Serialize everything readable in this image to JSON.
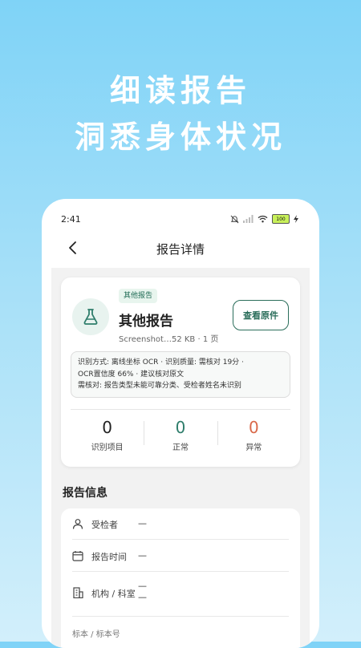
{
  "promo": {
    "line1": "细读报告",
    "line2": "洞悉身体状况"
  },
  "status_bar": {
    "time": "2:41",
    "battery": "100"
  },
  "nav": {
    "title": "报告详情"
  },
  "report": {
    "tag": "其他报告",
    "name": "其他报告",
    "file_info": "Screenshot…52 KB · 1 页",
    "view_button": "查看原件",
    "ocr_lines": [
      "识别方式: 离线坐标 OCR · 识别质量: 需核对 19分 ·",
      "OCR置信度 66% · 建议核对原文",
      "需核对: 报告类型未能可靠分类、受检者姓名未识别"
    ],
    "stats": [
      {
        "value": "0",
        "label": "识别项目",
        "color": "#222222"
      },
      {
        "value": "0",
        "label": "正常",
        "color": "#2e7d6b"
      },
      {
        "value": "0",
        "label": "异常",
        "color": "#d9694a"
      }
    ]
  },
  "info": {
    "section_title": "报告信息",
    "rows": [
      {
        "label": "受检者",
        "value": "—",
        "icon": "person-icon"
      },
      {
        "label": "报告时间",
        "value": "—",
        "icon": "calendar-icon"
      },
      {
        "label": "机构 / 科室",
        "value_lines": [
          "—",
          "—"
        ],
        "icon": "building-icon"
      },
      {
        "label": "标本 / 标本号"
      }
    ]
  }
}
